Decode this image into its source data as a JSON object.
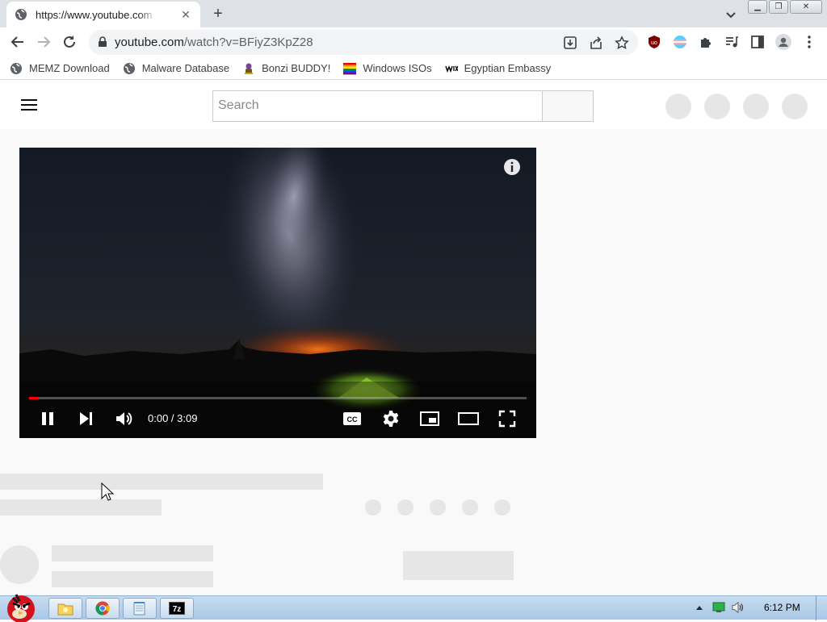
{
  "browser": {
    "tab_title": "https://www.youtube.com",
    "new_tab_label": "+",
    "url_host": "youtube.com",
    "url_path": "/watch?v=BFiyZ3KpZ28"
  },
  "bookmarks": [
    {
      "label": "MEMZ Download",
      "icon": "globe-icon"
    },
    {
      "label": "Malware Database",
      "icon": "globe-icon"
    },
    {
      "label": "Bonzi BUDDY!",
      "icon": "bonzi-icon"
    },
    {
      "label": "Windows ISOs",
      "icon": "rainbow-flag-icon"
    },
    {
      "label": "Egyptian Embassy",
      "icon": "wix-icon"
    }
  ],
  "youtube": {
    "search_placeholder": "Search"
  },
  "player": {
    "current_time": "0:00 / 3:09",
    "progress_fraction": 0.02,
    "cc_label": "CC"
  },
  "taskbar": {
    "clock": "6:12 PM",
    "tasks": [
      "explorer",
      "chrome",
      "notepad",
      "7-zip"
    ],
    "seven_zip_label": "7z"
  },
  "colors": {
    "accent_red": "#ff0000",
    "tab_strip": "#dee1e6",
    "taskbar": "#b9d3ec"
  }
}
